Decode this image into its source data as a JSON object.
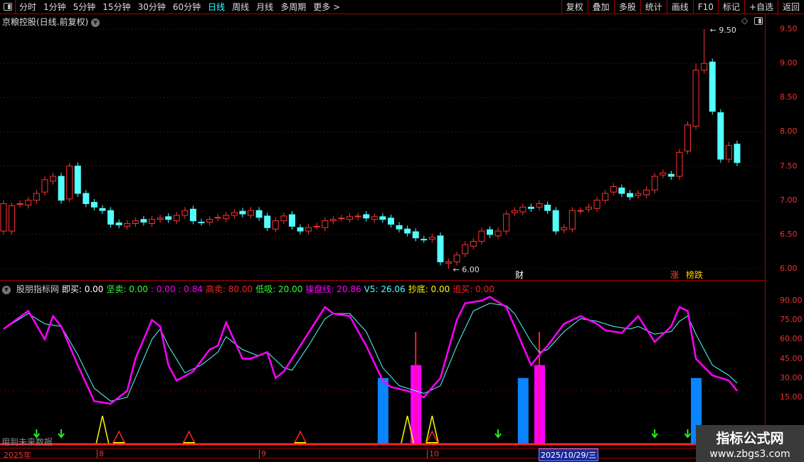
{
  "toolbar": {
    "periods": [
      "分时",
      "1分钟",
      "5分钟",
      "15分钟",
      "30分钟",
      "60分钟",
      "日线",
      "周线",
      "月线",
      "多周期",
      "更多 >"
    ],
    "active": "日线",
    "right": [
      "复权",
      "叠加",
      "多股",
      "统计",
      "画线",
      "F10",
      "标记",
      "+自选",
      "返回"
    ]
  },
  "stock_title": "京粮控股(日线.前复权)",
  "price_axis": [
    "9.50",
    "9.00",
    "8.50",
    "8.00",
    "7.50",
    "7.00",
    "6.50",
    "6.00"
  ],
  "high_label": "9.50",
  "low_label": "6.00",
  "markers": {
    "cai": "财",
    "zhang": "涨",
    "bangdie": "榜跌"
  },
  "colors": {
    "up": "#ff3232",
    "down": "#54ffff",
    "magenta": "#ff00ff",
    "cyan": "#54ffff",
    "blue": "#0a84ff"
  },
  "candles_close": [
    6.55,
    6.92,
    6.95,
    7.0,
    7.1,
    7.3,
    7.35,
    7.0,
    7.5,
    7.1,
    6.95,
    6.9,
    6.85,
    6.65,
    6.64,
    6.66,
    6.7,
    6.68,
    6.72,
    6.74,
    6.72,
    6.78,
    6.85,
    6.7,
    6.68,
    6.72,
    6.75,
    6.78,
    6.82,
    6.8,
    6.85,
    6.75,
    6.6,
    6.7,
    6.77,
    6.62,
    6.55,
    6.6,
    6.62,
    6.7,
    6.72,
    6.74,
    6.76,
    6.77,
    6.74,
    6.76,
    6.72,
    6.65,
    6.58,
    6.52,
    6.45,
    6.43,
    6.46,
    6.1,
    6.1,
    6.2,
    6.35,
    6.4,
    6.55,
    6.5,
    6.55,
    6.8,
    6.85,
    6.9,
    6.88,
    6.95,
    6.85,
    6.55,
    6.6,
    6.85,
    6.85,
    6.9,
    7.0,
    7.1,
    7.2,
    7.1,
    7.05,
    7.1,
    7.15,
    7.35,
    7.4,
    7.35,
    7.7,
    8.1,
    8.9,
    9.0,
    8.3,
    7.6,
    7.8,
    7.55
  ],
  "indicator": {
    "name": "股朋指标网",
    "legend": [
      {
        "t": "即买: 0.00",
        "c": "#fff"
      },
      {
        "t": "坚卖: 0.00",
        "c": "#3f3"
      },
      {
        "t": ": 0.00 : 0.84",
        "c": "#f0f"
      },
      {
        "t": "高卖: 80.00",
        "c": "#f22"
      },
      {
        "t": "低吸: 20.00",
        "c": "#3f3"
      },
      {
        "t": "操盘线: 20.86",
        "c": "#f0f"
      },
      {
        "t": "V5: 26.06",
        "c": "#5ff"
      },
      {
        "t": "抄底: 0.00",
        "c": "#ff0"
      },
      {
        "t": "追买: 0.00",
        "c": "#f22"
      }
    ],
    "axis": [
      "90.00",
      "75.00",
      "60.00",
      "45.00",
      "30.00",
      "15.00"
    ],
    "magenta": [
      [
        0,
        68
      ],
      [
        3,
        82
      ],
      [
        5,
        60
      ],
      [
        6,
        78
      ],
      [
        7,
        70
      ],
      [
        9,
        40
      ],
      [
        11,
        12
      ],
      [
        13,
        10
      ],
      [
        15,
        20
      ],
      [
        16,
        45
      ],
      [
        18,
        75
      ],
      [
        19,
        70
      ],
      [
        20,
        40
      ],
      [
        21,
        28
      ],
      [
        23,
        35
      ],
      [
        25,
        52
      ],
      [
        26,
        55
      ],
      [
        27,
        73
      ],
      [
        29,
        45
      ],
      [
        30,
        45
      ],
      [
        32,
        50
      ],
      [
        33,
        30
      ],
      [
        34,
        35
      ],
      [
        36,
        55
      ],
      [
        37,
        65
      ],
      [
        39,
        85
      ],
      [
        40,
        80
      ],
      [
        42,
        78
      ],
      [
        44,
        55
      ],
      [
        46,
        28
      ],
      [
        47,
        23
      ],
      [
        49,
        20
      ],
      [
        51,
        15
      ],
      [
        53,
        30
      ],
      [
        55,
        75
      ],
      [
        56,
        88
      ],
      [
        58,
        90
      ],
      [
        59,
        93
      ],
      [
        61,
        85
      ],
      [
        62,
        70
      ],
      [
        64,
        40
      ],
      [
        65,
        48
      ],
      [
        66,
        55
      ],
      [
        68,
        72
      ],
      [
        70,
        78
      ],
      [
        72,
        72
      ],
      [
        73,
        67
      ],
      [
        75,
        65
      ],
      [
        77,
        78
      ],
      [
        79,
        58
      ],
      [
        81,
        70
      ],
      [
        82,
        85
      ],
      [
        83,
        82
      ],
      [
        84,
        45
      ],
      [
        86,
        32
      ],
      [
        88,
        28
      ],
      [
        89,
        20
      ]
    ],
    "cyan": [
      [
        0,
        68
      ],
      [
        3,
        80
      ],
      [
        5,
        72
      ],
      [
        7,
        70
      ],
      [
        9,
        48
      ],
      [
        11,
        22
      ],
      [
        13,
        12
      ],
      [
        15,
        15
      ],
      [
        16,
        30
      ],
      [
        18,
        60
      ],
      [
        19,
        68
      ],
      [
        20,
        55
      ],
      [
        22,
        34
      ],
      [
        24,
        40
      ],
      [
        26,
        50
      ],
      [
        27,
        62
      ],
      [
        29,
        52
      ],
      [
        31,
        47
      ],
      [
        32,
        50
      ],
      [
        34,
        38
      ],
      [
        35,
        36
      ],
      [
        37,
        55
      ],
      [
        39,
        76
      ],
      [
        40,
        80
      ],
      [
        42,
        80
      ],
      [
        44,
        66
      ],
      [
        46,
        38
      ],
      [
        48,
        24
      ],
      [
        50,
        20
      ],
      [
        51,
        18
      ],
      [
        53,
        24
      ],
      [
        55,
        55
      ],
      [
        57,
        82
      ],
      [
        59,
        88
      ],
      [
        61,
        86
      ],
      [
        62,
        80
      ],
      [
        64,
        58
      ],
      [
        65,
        50
      ],
      [
        66,
        52
      ],
      [
        68,
        66
      ],
      [
        70,
        76
      ],
      [
        72,
        74
      ],
      [
        74,
        70
      ],
      [
        76,
        68
      ],
      [
        77,
        70
      ],
      [
        79,
        64
      ],
      [
        81,
        66
      ],
      [
        82,
        74
      ],
      [
        83,
        78
      ],
      [
        84,
        64
      ],
      [
        86,
        40
      ],
      [
        88,
        32
      ],
      [
        89,
        26
      ]
    ],
    "bars": [
      {
        "day": 46,
        "v": 30,
        "c": "blue"
      },
      {
        "day": 50,
        "v": 40,
        "c": "magenta"
      },
      {
        "day": 63,
        "v": 30,
        "c": "blue"
      },
      {
        "day": 65,
        "v": 40,
        "c": "magenta"
      },
      {
        "day": 84,
        "v": 30,
        "c": "blue"
      }
    ],
    "spikes": [
      50,
      65
    ],
    "yellow_peaks": [
      12,
      49,
      52
    ],
    "red_triangles": [
      14,
      22.5,
      36,
      52
    ],
    "green_arrows": [
      4,
      7,
      60,
      79,
      83
    ]
  },
  "footer_text": "用到未来数据",
  "dates": {
    "year": "2025年",
    "months": [
      "8",
      "9",
      "10"
    ],
    "cursor": "2025/10/29/三"
  },
  "watermark": {
    "line1": "指标公式网",
    "line2": "www.zbgs3.com"
  }
}
